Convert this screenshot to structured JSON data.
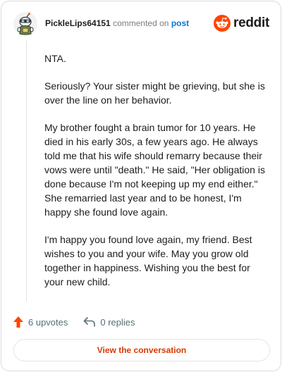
{
  "comment": {
    "username": "PickleLips64151",
    "action_text": "commented on",
    "post_link": "post",
    "avatar_icon": "snoo-avatar-icon"
  },
  "brand": {
    "logo_icon": "reddit-logo-icon",
    "wordmark": "reddit",
    "color": "#ff4500"
  },
  "body": {
    "paragraphs": [
      "NTA.",
      "Seriously? Your sister might be grieving, but she is over the line on her behavior.",
      "My brother fought a brain tumor for 10 years. He died in his early 30s, a few years ago. He always told me that his wife should remarry because their vows were until \"death.\" He said, \"Her obligation is done because I'm not keeping up my end either.\" She remarried last year and to be honest, I'm happy she found love again.",
      "I'm happy you found love again, my friend. Best wishes to you and your wife. May you grow old together in happiness. Wishing you the best for your new child."
    ]
  },
  "actions": {
    "upvotes": "6 upvotes",
    "replies": "0 replies",
    "upvote_icon": "upvote-arrow-icon",
    "reply_icon": "reply-arrow-icon",
    "upvote_color": "#ff4500"
  },
  "footer": {
    "view_button": "View the conversation",
    "accent": "#d93a00"
  }
}
